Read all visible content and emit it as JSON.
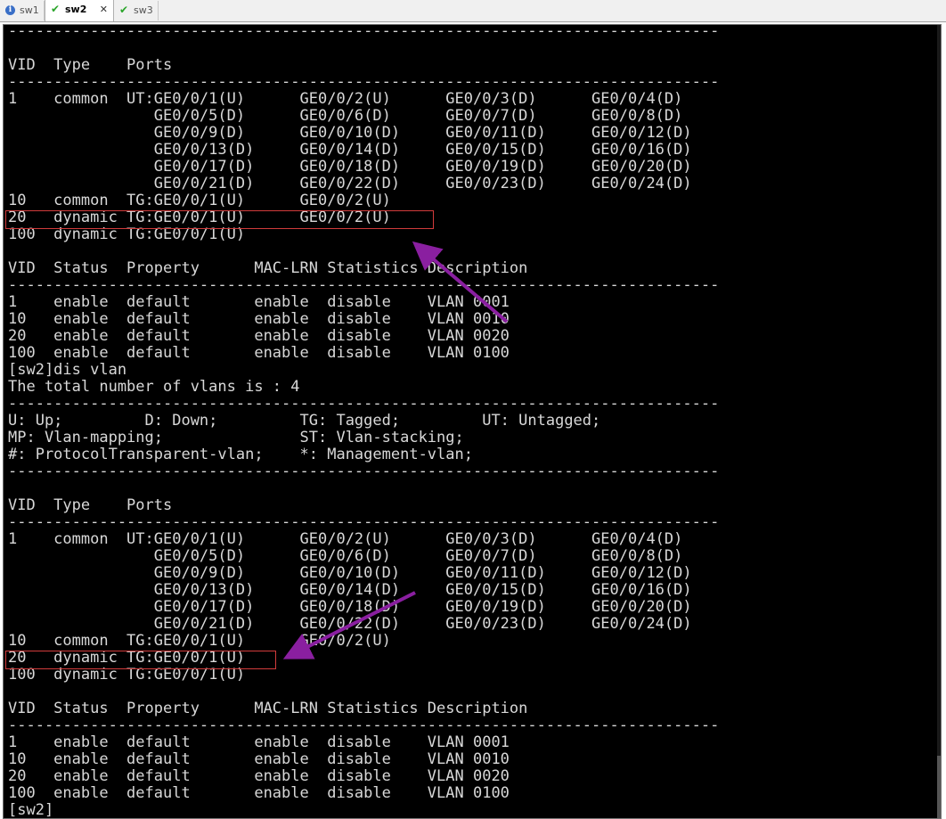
{
  "tabs": [
    {
      "label": "sw1",
      "icon": "info-icon",
      "active": false
    },
    {
      "label": "sw2",
      "icon": "check-icon",
      "active": true,
      "close": "✕"
    },
    {
      "label": "sw3",
      "icon": "check-icon",
      "active": false
    }
  ],
  "terminal": {
    "lines": [
      "------------------------------------------------------------------------------",
      "",
      "VID  Type    Ports",
      "------------------------------------------------------------------------------",
      "1    common  UT:GE0/0/1(U)      GE0/0/2(U)      GE0/0/3(D)      GE0/0/4(D)",
      "                GE0/0/5(D)      GE0/0/6(D)      GE0/0/7(D)      GE0/0/8(D)",
      "                GE0/0/9(D)      GE0/0/10(D)     GE0/0/11(D)     GE0/0/12(D)",
      "                GE0/0/13(D)     GE0/0/14(D)     GE0/0/15(D)     GE0/0/16(D)",
      "                GE0/0/17(D)     GE0/0/18(D)     GE0/0/19(D)     GE0/0/20(D)",
      "                GE0/0/21(D)     GE0/0/22(D)     GE0/0/23(D)     GE0/0/24(D)",
      "10   common  TG:GE0/0/1(U)      GE0/0/2(U)",
      "20   dynamic TG:GE0/0/1(U)      GE0/0/2(U)",
      "100  dynamic TG:GE0/0/1(U)",
      "",
      "VID  Status  Property      MAC-LRN Statistics Description",
      "------------------------------------------------------------------------------",
      "1    enable  default       enable  disable    VLAN 0001",
      "10   enable  default       enable  disable    VLAN 0010",
      "20   enable  default       enable  disable    VLAN 0020",
      "100  enable  default       enable  disable    VLAN 0100",
      "[sw2]dis vlan",
      "The total number of vlans is : 4",
      "------------------------------------------------------------------------------",
      "U: Up;         D: Down;         TG: Tagged;         UT: Untagged;",
      "MP: Vlan-mapping;               ST: Vlan-stacking;",
      "#: ProtocolTransparent-vlan;    *: Management-vlan;",
      "------------------------------------------------------------------------------",
      "",
      "VID  Type    Ports",
      "------------------------------------------------------------------------------",
      "1    common  UT:GE0/0/1(U)      GE0/0/2(U)      GE0/0/3(D)      GE0/0/4(D)",
      "                GE0/0/5(D)      GE0/0/6(D)      GE0/0/7(D)      GE0/0/8(D)",
      "                GE0/0/9(D)      GE0/0/10(D)     GE0/0/11(D)     GE0/0/12(D)",
      "                GE0/0/13(D)     GE0/0/14(D)     GE0/0/15(D)     GE0/0/16(D)",
      "                GE0/0/17(D)     GE0/0/18(D)     GE0/0/19(D)     GE0/0/20(D)",
      "                GE0/0/21(D)     GE0/0/22(D)     GE0/0/23(D)     GE0/0/24(D)",
      "10   common  TG:GE0/0/1(U)      GE0/0/2(U)",
      "20   dynamic TG:GE0/0/1(U)",
      "100  dynamic TG:GE0/0/1(U)",
      "",
      "VID  Status  Property      MAC-LRN Statistics Description",
      "------------------------------------------------------------------------------",
      "1    enable  default       enable  disable    VLAN 0001",
      "10   enable  default       enable  disable    VLAN 0010",
      "20   enable  default       enable  disable    VLAN 0020",
      "100  enable  default       enable  disable    VLAN 0100",
      "[sw2]"
    ]
  },
  "annotation_color": "#8a1fa0",
  "highlight_color": "#d23b3b"
}
